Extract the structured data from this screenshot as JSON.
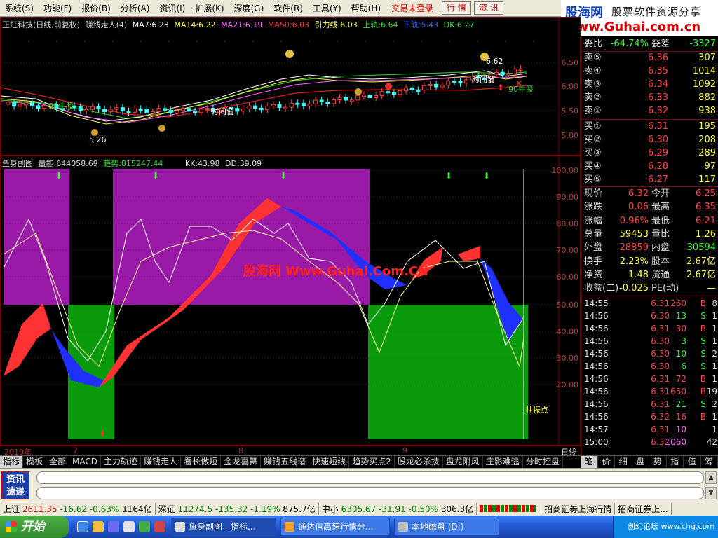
{
  "menu": {
    "items": [
      "系统(S)",
      "功能(F)",
      "报价(B)",
      "分析(A)",
      "资讯(I)",
      "扩展(K)",
      "深度(G)",
      "软件(R)",
      "工具(Y)",
      "帮助(H)"
    ],
    "trade_status": "交易未登录",
    "btn_quote": "行 情",
    "btn_info": "资 讯"
  },
  "logo": {
    "line1": "股海网",
    "line1b": "股票软件资源分享",
    "line2": "www.Guhai.com.cn"
  },
  "main_legend": {
    "stock": "正虹科技(日线,前复权)",
    "indicator": "赚钱走人(4)",
    "ma7": "MA7:6.23",
    "ma14": "MA14:6.22",
    "ma21": "MA21:6.19",
    "ma50": "MA50:6.03",
    "yinli": "引力线:6.03",
    "upper": "上轨:6.64",
    "lower": "下轨:5.43",
    "dk": "DK:6.27"
  },
  "main_axis": [
    "6.50",
    "6.00",
    "5.50",
    "5.00"
  ],
  "main_labels": {
    "time_window_1": "时间窗",
    "time_window_2": "时间窗",
    "buy_1": "90牛股",
    "buy_2": "90牛股",
    "price_tag": "6.62",
    "low_tag": "5.26"
  },
  "sub_legend": {
    "name": "鱼身副图",
    "volume": "量能:644058.69",
    "trend": "趋势:815247.44",
    "kk": "KK:43.98",
    "dd": "DD:39.09"
  },
  "sub_axis": [
    "100.00",
    "90.00",
    "80.00",
    "70.00",
    "60.00",
    "50.00",
    "40.00",
    "30.00",
    "20.00"
  ],
  "sub_labels": {
    "watermark": "股海网 Www.Guhai.Com.CN",
    "resonance": "共振点"
  },
  "datebar": {
    "year": "2010年",
    "m7": "7",
    "m8": "8",
    "m9": "9",
    "period": "日线"
  },
  "tabs": [
    "指标",
    "模板",
    "全部",
    "MACD",
    "主力轨迹",
    "赚钱走人",
    "看长做短",
    "金龙喜舞",
    "赚钱五线谱",
    "快速短线",
    "趋势买点2",
    "股龙必杀技",
    "盘龙附风",
    "庄影难逃",
    "分时控盘"
  ],
  "quote": {
    "weibi_label": "委比",
    "weibi": "-64.74%",
    "weicha_label": "委差",
    "weicha": "-3327",
    "asks": [
      {
        "label": "卖⑤",
        "price": "6.36",
        "vol": "307"
      },
      {
        "label": "卖④",
        "price": "6.35",
        "vol": "1014"
      },
      {
        "label": "卖③",
        "price": "6.34",
        "vol": "1092"
      },
      {
        "label": "卖②",
        "price": "6.33",
        "vol": "882"
      },
      {
        "label": "卖①",
        "price": "6.32",
        "vol": "938"
      }
    ],
    "bids": [
      {
        "label": "买①",
        "price": "6.31",
        "vol": "195"
      },
      {
        "label": "买②",
        "price": "6.30",
        "vol": "208"
      },
      {
        "label": "买③",
        "price": "6.29",
        "vol": "289"
      },
      {
        "label": "买④",
        "price": "6.28",
        "vol": "97"
      },
      {
        "label": "买⑤",
        "price": "6.27",
        "vol": "117"
      }
    ],
    "stats": [
      {
        "l1": "现价",
        "v1": "6.32",
        "l2": "今开",
        "v2": "6.25",
        "c1": "#ff4444",
        "c2": "#ff4444"
      },
      {
        "l1": "涨跌",
        "v1": "0.06",
        "l2": "最高",
        "v2": "6.35",
        "c1": "#ff4444",
        "c2": "#ff4444"
      },
      {
        "l1": "涨幅",
        "v1": "0.96%",
        "l2": "最低",
        "v2": "6.21",
        "c1": "#ff4444",
        "c2": "#ff4444"
      },
      {
        "l1": "总量",
        "v1": "59453",
        "l2": "量比",
        "v2": "1.26",
        "c1": "#ffff44",
        "c2": "#ffff44"
      },
      {
        "l1": "外盘",
        "v1": "28859",
        "l2": "内盘",
        "v2": "30594",
        "c1": "#ff4444",
        "c2": "#33ff33"
      },
      {
        "l1": "换手",
        "v1": "2.23%",
        "l2": "股本",
        "v2": "2.67亿",
        "c1": "#ffff44",
        "c2": "#ffff44"
      },
      {
        "l1": "净资",
        "v1": "1.48",
        "l2": "流通",
        "v2": "2.67亿",
        "c1": "#ffff44",
        "c2": "#ffff44"
      },
      {
        "l1": "收益(二)",
        "v1": "-0.025",
        "l2": "PE(动)",
        "v2": "—",
        "c1": "#ffff44",
        "c2": "#ffff44"
      }
    ],
    "trades": [
      {
        "t": "14:55",
        "p": "6.31",
        "v": "260",
        "s": "B",
        "n": "8"
      },
      {
        "t": "14:56",
        "p": "6.30",
        "v": "13",
        "s": "S",
        "n": "1"
      },
      {
        "t": "14:56",
        "p": "6.31",
        "v": "30",
        "s": "B",
        "n": "1"
      },
      {
        "t": "14:56",
        "p": "6.30",
        "v": "3",
        "s": "S",
        "n": "1"
      },
      {
        "t": "14:56",
        "p": "6.30",
        "v": "10",
        "s": "S",
        "n": "2"
      },
      {
        "t": "14:56",
        "p": "6.30",
        "v": "6",
        "s": "S",
        "n": "1"
      },
      {
        "t": "14:56",
        "p": "6.31",
        "v": "72",
        "s": "B",
        "n": "1"
      },
      {
        "t": "14:56",
        "p": "6.31",
        "v": "650",
        "s": "B",
        "n": "19"
      },
      {
        "t": "14:56",
        "p": "6.31",
        "v": "21",
        "s": "S",
        "n": "2"
      },
      {
        "t": "14:56",
        "p": "6.32",
        "v": "16",
        "s": "B",
        "n": "1"
      },
      {
        "t": "14:57",
        "p": "6.31",
        "v": "10",
        "s": "",
        "n": "1"
      },
      {
        "t": "15:00",
        "p": "6.32",
        "v": "1060",
        "s": "",
        "n": "42"
      }
    ],
    "tabs": [
      "笔",
      "价",
      "细",
      "盘",
      "势",
      "指",
      "值",
      "筹"
    ]
  },
  "news": {
    "icon_text": "资讯\n速递"
  },
  "indexbar": {
    "sh_label": "上证",
    "sh_val": "2611.35",
    "sh_chg": "-16.62",
    "sh_pct": "-0.63%",
    "sh_amt": "1164亿",
    "sz_label": "深证",
    "sz_val": "11274.5",
    "sz_chg": "-135.32",
    "sz_pct": "-1.19%",
    "sz_amt": "875.7亿",
    "zx_label": "中小",
    "zx_val": "6305.67",
    "zx_chg": "-31.91",
    "zx_pct": "-0.50%",
    "zx_amt": "306.3亿",
    "broker1": "招商证券上海行情",
    "broker2": "招商证券上..."
  },
  "taskbar": {
    "start": "开始",
    "tasks": [
      "鱼身副图 - 指标...",
      "通达信高速行情分...",
      "本地磁盘 (D:)"
    ],
    "tray": "创幻论坛 www.chg.com"
  },
  "chart_data": {
    "type": "line",
    "title": "正虹科技(日线,前复权)",
    "price_axis_range": [
      4.9,
      6.65
    ],
    "oscillator_range": [
      0,
      100
    ]
  }
}
